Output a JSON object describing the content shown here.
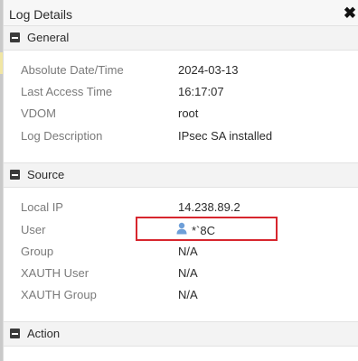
{
  "window": {
    "title": "Log Details",
    "close_glyph": "✖"
  },
  "general": {
    "title": "General",
    "rows": [
      {
        "label": "Absolute Date/Time",
        "value": "2024-03-13"
      },
      {
        "label": "Last Access Time",
        "value": "16:17:07"
      },
      {
        "label": "VDOM",
        "value": "root"
      },
      {
        "label": "Log Description",
        "value": "IPsec SA installed"
      }
    ]
  },
  "source": {
    "title": "Source",
    "rows": [
      {
        "label": "Local IP",
        "value": "14.238.89.2"
      },
      {
        "label": "User",
        "value": "*`8C",
        "icon": "user-icon"
      },
      {
        "label": "Group",
        "value": "N/A"
      },
      {
        "label": "XAUTH User",
        "value": "N/A"
      },
      {
        "label": "XAUTH Group",
        "value": "N/A"
      }
    ]
  },
  "action": {
    "title": "Action"
  },
  "colors": {
    "highlight": "#d7262e",
    "user_icon": "#6e9fd8"
  }
}
